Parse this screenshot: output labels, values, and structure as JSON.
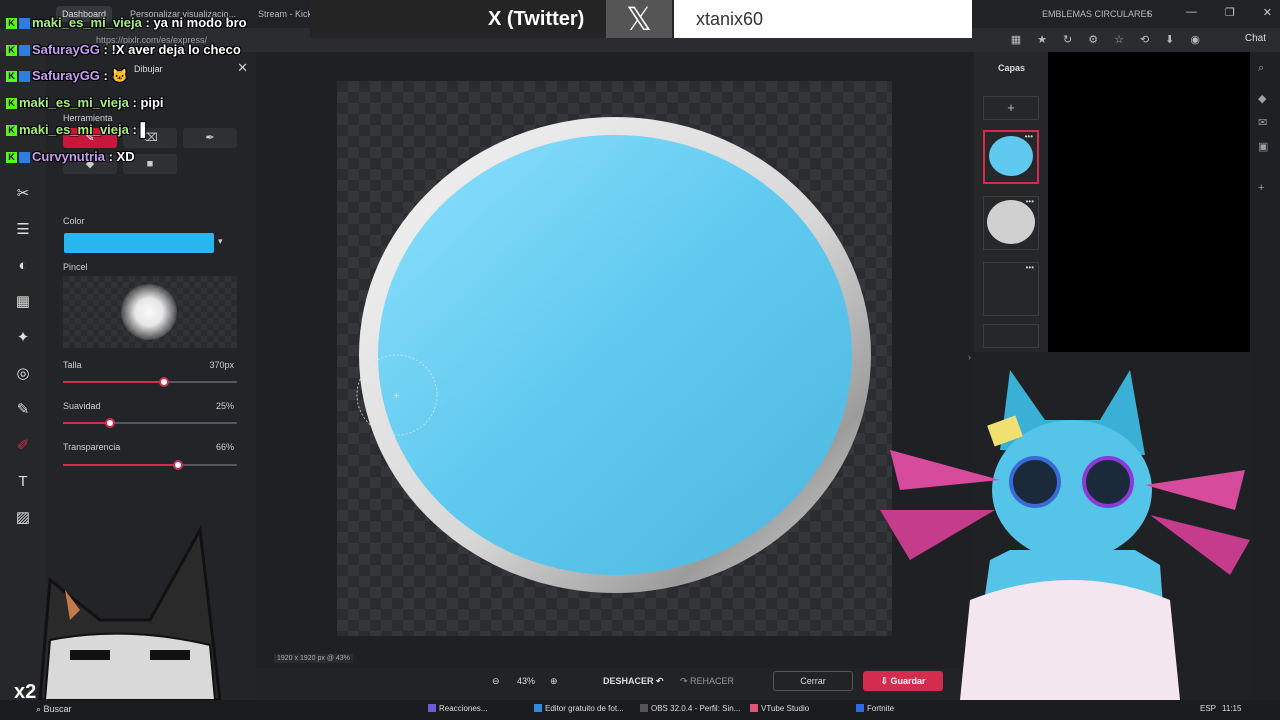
{
  "browser": {
    "tabs": [
      "Dashboard",
      "Personalizar visualizacio...",
      "Stream - Kick",
      "EMBLEMAS CIRCULARES"
    ],
    "url": "https://pixlr.com/es/express/",
    "chat_label": "Chat"
  },
  "banner": {
    "platform": "X (Twitter)",
    "logo": "𝕏",
    "handle": "xtanix60"
  },
  "chat": [
    {
      "user": "maki_es_mi_vieja",
      "message": "ya ni modo bro",
      "color": "green"
    },
    {
      "user": "SafurayGG",
      "message": "!X aver deja lo checo",
      "color": "purple"
    },
    {
      "user": "SafurayGG",
      "message": "",
      "color": "purple"
    },
    {
      "user": "maki_es_mi_vieja",
      "message": "pipi",
      "color": "green"
    },
    {
      "user": "maki_es_mi_vieja",
      "message": "",
      "color": "green"
    },
    {
      "user": "Curvynutria",
      "message": "XD",
      "color": "purple"
    }
  ],
  "panel": {
    "title": "Dibujar",
    "tool_label": "Herramienta",
    "color_label": "Color",
    "color_value": "#29b6ee",
    "brush_label": "Pincel",
    "sliders": [
      {
        "label": "Talla",
        "value_text": "370px",
        "fraction": 0.58
      },
      {
        "label": "Suavidad",
        "value_text": "25%",
        "fraction": 0.27
      },
      {
        "label": "Transparencia",
        "value_text": "66%",
        "fraction": 0.66
      }
    ]
  },
  "canvas": {
    "size_label": "1920 x 1920 px @ 43%",
    "fill_color": "#5fc9ef",
    "ring_color": "#d8d8d8"
  },
  "bottom": {
    "zoom": "43%",
    "undo": "DESHACER",
    "redo": "REHACER",
    "close": "Cerrar",
    "save": "Guardar"
  },
  "layers": {
    "title": "Capas"
  },
  "taskbar": {
    "search": "Buscar",
    "items": [
      "Reacciones...",
      "Editor gratuito de fot...",
      "OBS 32.0.4 - Perfil: Sin...",
      "VTube Studio",
      "Fortnite"
    ],
    "lang": "ESP",
    "time": "11:15"
  }
}
